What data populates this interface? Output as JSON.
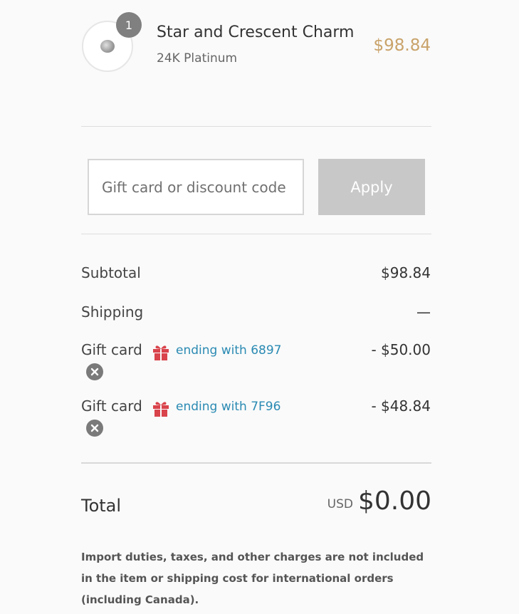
{
  "product": {
    "quantity": "1",
    "name": "Star and Crescent Charm",
    "variant": "24K Platinum",
    "price": "$98.84"
  },
  "discount": {
    "placeholder": "Gift card or discount code",
    "value": "",
    "apply_label": "Apply"
  },
  "summary": {
    "subtotal_label": "Subtotal",
    "subtotal_value": "$98.84",
    "shipping_label": "Shipping",
    "shipping_value": "—",
    "gift_cards": [
      {
        "label": "Gift card",
        "ending": "ending with 6897",
        "amount": "- $50.00"
      },
      {
        "label": "Gift card",
        "ending": "ending with 7F96",
        "amount": "- $48.84"
      }
    ]
  },
  "total": {
    "label": "Total",
    "currency": "USD",
    "amount": "$0.00"
  },
  "notice": "Import duties, taxes, and other charges are not included in the item or shipping cost for international orders (including Canada).",
  "colors": {
    "price_accent": "#c9a36a",
    "link": "#2a8ab3",
    "gift_icon": "#d9434b",
    "apply_disabled": "#c8c8c8"
  },
  "icons": {
    "gift": "gift-icon",
    "remove": "close-icon"
  }
}
